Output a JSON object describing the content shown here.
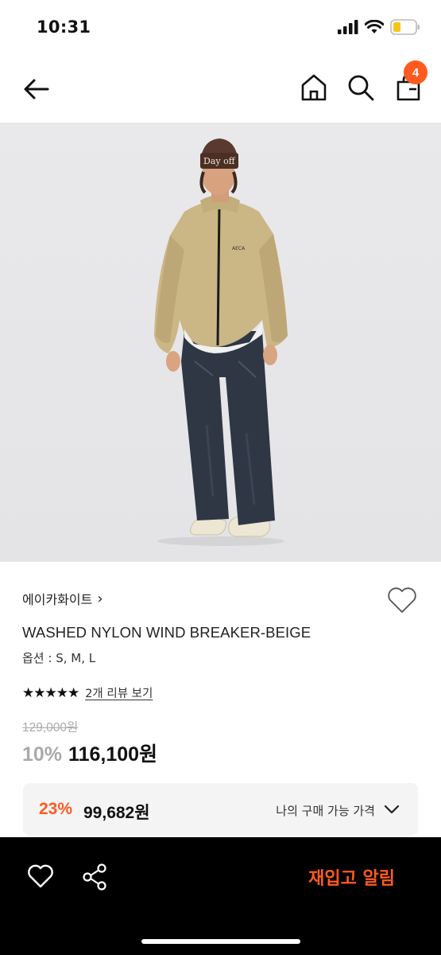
{
  "status_bar": {
    "time": "10:31"
  },
  "nav": {
    "cart_count": "4",
    "icons": [
      "back-arrow-icon",
      "home-icon",
      "search-icon",
      "shopping-bag-icon"
    ]
  },
  "product": {
    "brand": "에이카화이트",
    "brand_chevron": "›",
    "name": "WASHED NYLON WIND BREAKER-BEIGE",
    "options": "옵션 : S, M, L",
    "stars": "★★★★★",
    "review_link": "2개 리뷰 보기",
    "original_price": "129,000원",
    "discount": "10%",
    "price": "116,100원",
    "hat_text": "Day off",
    "jacket_logo": "AECA"
  },
  "member_price": {
    "discount": "23%",
    "price": "99,682원",
    "label": "나의 구매 가능 가격"
  },
  "bottom_bar": {
    "restock_label": "재입고 알림"
  },
  "colors": {
    "accent": "#ff5a1f",
    "bar": "#000000",
    "box": "#f4f4f5"
  }
}
